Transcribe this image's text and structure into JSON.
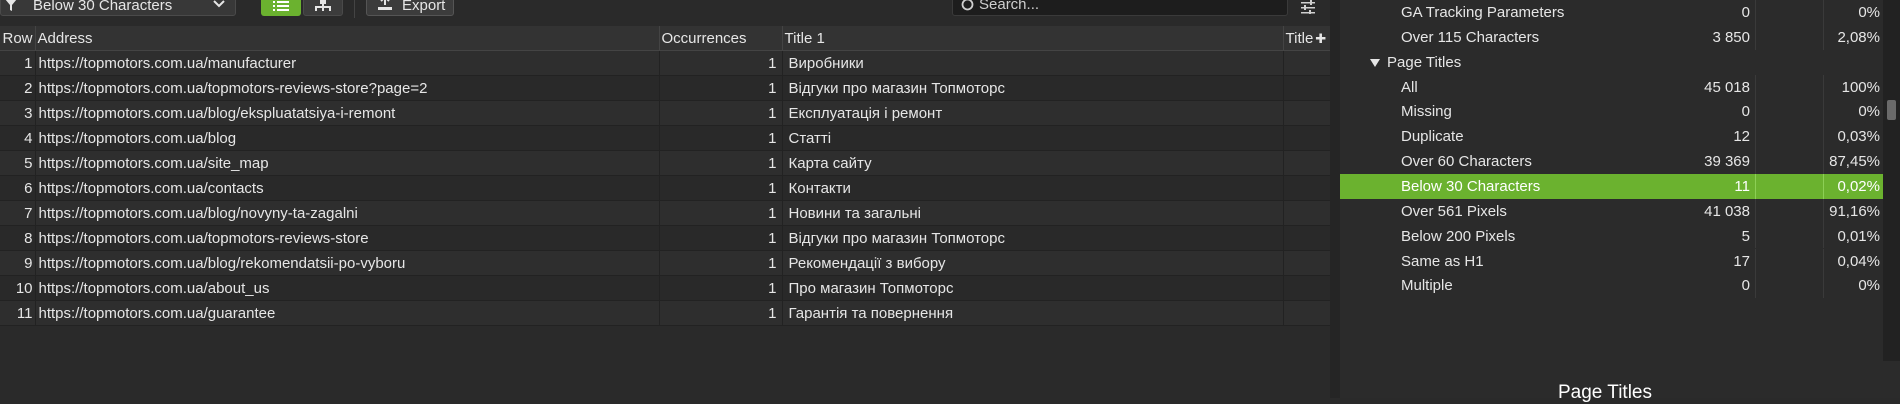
{
  "toolbar": {
    "filter_value": "Below 30 Characters",
    "export_label": "Export",
    "search_placeholder": "Search..."
  },
  "table": {
    "columns": [
      "Row",
      "Address",
      "Occurrences",
      "Title 1",
      "Title"
    ],
    "rows": [
      {
        "row": "1",
        "address": "https://topmotors.com.ua/manufacturer",
        "occurrences": "1",
        "title": "Виробники"
      },
      {
        "row": "2",
        "address": "https://topmotors.com.ua/topmotors-reviews-store?page=2",
        "occurrences": "1",
        "title": "Відгуки про магазин Топмоторс"
      },
      {
        "row": "3",
        "address": "https://topmotors.com.ua/blog/ekspluatatsiya-i-remont",
        "occurrences": "1",
        "title": "Експлуатація і ремонт"
      },
      {
        "row": "4",
        "address": "https://topmotors.com.ua/blog",
        "occurrences": "1",
        "title": "Статті"
      },
      {
        "row": "5",
        "address": "https://topmotors.com.ua/site_map",
        "occurrences": "1",
        "title": "Карта сайту"
      },
      {
        "row": "6",
        "address": "https://topmotors.com.ua/contacts",
        "occurrences": "1",
        "title": "Контакти"
      },
      {
        "row": "7",
        "address": "https://topmotors.com.ua/blog/novyny-ta-zagalni",
        "occurrences": "1",
        "title": "Новини та загальні"
      },
      {
        "row": "8",
        "address": "https://topmotors.com.ua/topmotors-reviews-store",
        "occurrences": "1",
        "title": "Відгуки про магазин Топмоторс"
      },
      {
        "row": "9",
        "address": "https://topmotors.com.ua/blog/rekomendatsii-po-vyboru",
        "occurrences": "1",
        "title": "Рекомендації з вибору"
      },
      {
        "row": "10",
        "address": "https://topmotors.com.ua/about_us",
        "occurrences": "1",
        "title": "Про магазин Топмоторс"
      },
      {
        "row": "11",
        "address": "https://topmotors.com.ua/guarantee",
        "occurrences": "1",
        "title": "Гарантія та повернення"
      }
    ]
  },
  "overview": {
    "items": [
      {
        "label": "GA Tracking Parameters",
        "count": "0",
        "percent": "0%"
      },
      {
        "label": "Over 115 Characters",
        "count": "3 850",
        "percent": "2,08%"
      },
      {
        "label": "Page Titles",
        "count": "",
        "percent": ""
      },
      {
        "label": "All",
        "count": "45 018",
        "percent": "100%"
      },
      {
        "label": "Missing",
        "count": "0",
        "percent": "0%"
      },
      {
        "label": "Duplicate",
        "count": "12",
        "percent": "0,03%"
      },
      {
        "label": "Over 60 Characters",
        "count": "39 369",
        "percent": "87,45%"
      },
      {
        "label": "Below 30 Characters",
        "count": "11",
        "percent": "0,02%"
      },
      {
        "label": "Over 561 Pixels",
        "count": "41 038",
        "percent": "91,16%"
      },
      {
        "label": "Below 200 Pixels",
        "count": "5",
        "percent": "0,01%"
      },
      {
        "label": "Same as H1",
        "count": "17",
        "percent": "0,04%"
      },
      {
        "label": "Multiple",
        "count": "0",
        "percent": "0%"
      }
    ],
    "selected_label": "Below 30 Characters"
  },
  "bottom_panel": {
    "title": "Page Titles"
  },
  "colors": {
    "accent": "#6bb22f",
    "background": "#2a2a2a"
  }
}
